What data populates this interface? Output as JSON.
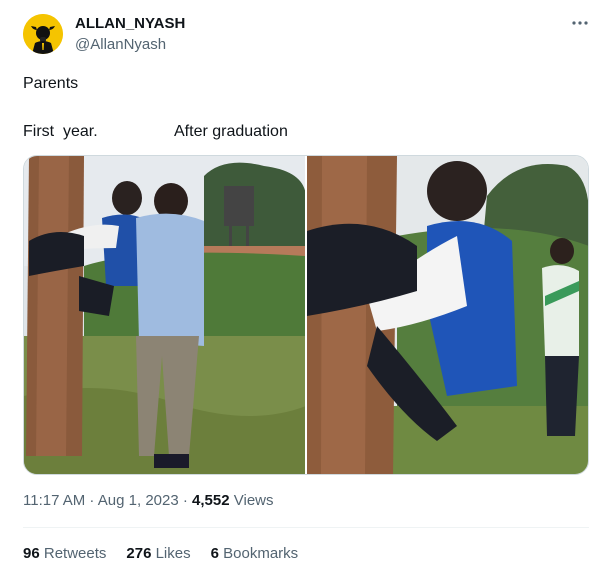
{
  "author": {
    "name": "ALLAN_NYASH",
    "handle": "@AllanNyash",
    "avatar_icon": "bull-avatar-icon"
  },
  "post": {
    "line1": "Parents",
    "caption_left": "First  year.",
    "caption_right": "After graduation"
  },
  "media": {
    "photos": [
      {
        "label": "first-year"
      },
      {
        "label": "after-graduation"
      }
    ]
  },
  "meta": {
    "time": "11:17 AM",
    "sep1": " · ",
    "date": "Aug 1, 2023",
    "sep2": " · ",
    "views_count": "4,552",
    "views_label": "Views"
  },
  "stats": {
    "retweets_count": "96",
    "retweets_label": "Retweets",
    "likes_count": "276",
    "likes_label": "Likes",
    "bookmarks_count": "6",
    "bookmarks_label": "Bookmarks"
  },
  "more_icon": "more-dots-icon"
}
